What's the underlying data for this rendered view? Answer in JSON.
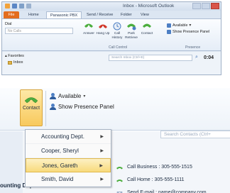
{
  "window": {
    "title": "Inbox - Microsoft Outlook",
    "tabs": [
      "File",
      "Home",
      "Panasonic PBX",
      "Send / Receive",
      "Folder",
      "View"
    ],
    "active_tab": "Panasonic PBX"
  },
  "ribbon": {
    "dial_label": "Dial",
    "dial_placeholder": "No Calls",
    "call_control_buttons": [
      {
        "label": "Answer",
        "icon": "answer-phone-icon"
      },
      {
        "label": "Hang Up",
        "icon": "hang-up-icon"
      },
      {
        "label": "Call History",
        "icon": "call-history-icon"
      },
      {
        "label": "Park Retrieve",
        "icon": "park-retrieve-icon"
      },
      {
        "label": "Contact",
        "icon": "contact-phone-icon"
      }
    ],
    "call_control_group": "Call Control",
    "available_label": "Available",
    "presence_panel_label": "Show Presence Panel",
    "presence_group": "Presence"
  },
  "nav": {
    "favorites_label": "Favorites",
    "inbox_label": "Inbox",
    "search_placeholder": "Search Inbox (Ctrl+E)",
    "timer": "0:04"
  },
  "zoom": {
    "contact_label": "Contact",
    "available_label": "Available",
    "presence_panel_label": "Show Presence Panel",
    "search_placeholder": "Search Contacts (Ctrl+",
    "list_heading": "ounting Dept.",
    "menu_items": [
      {
        "label": "Accounting Dept."
      },
      {
        "label": "Cooper, Sheryl"
      },
      {
        "label": "Jones, Gareth"
      },
      {
        "label": "Smith, David"
      }
    ],
    "highlighted_item": "Jones, Gareth",
    "submenu": [
      {
        "label": "Call Business : 305-555-1515",
        "icon": "phone-icon"
      },
      {
        "label": "Call Home : 305-555-1111",
        "icon": "phone-icon"
      },
      {
        "label": "Send E-mail : name@company.com",
        "icon": "envelope-icon"
      }
    ]
  },
  "colors": {
    "file_tab": "#e36c1d",
    "phone_green": "#4cae3e",
    "hangup_red": "#d13a2c",
    "highlight": "#f8da7c"
  }
}
